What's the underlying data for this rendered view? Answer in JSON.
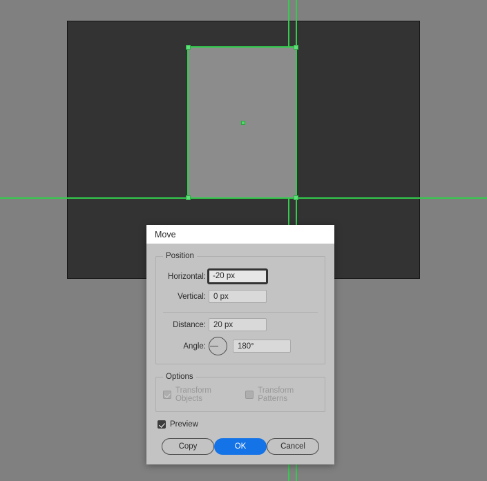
{
  "canvas": {
    "background_color": "#808080",
    "artboard_color": "#333333",
    "shape_fill": "#8c8c8c",
    "guide_color": "#33cc4d",
    "selection_color": "#5ee07a"
  },
  "dialog": {
    "title": "Move",
    "position_group": {
      "legend": "Position",
      "fields": [
        {
          "label": "Horizontal:",
          "value": "-20 px",
          "focused": true
        },
        {
          "label": "Vertical:",
          "value": "0 px",
          "focused": false
        },
        {
          "label": "Distance:",
          "value": "20 px",
          "focused": false
        },
        {
          "label": "Angle:",
          "value": "180°",
          "focused": false
        }
      ],
      "angle_degrees": 180
    },
    "options_group": {
      "legend": "Options",
      "checkboxes": [
        {
          "label": "Transform Objects",
          "checked": true,
          "enabled": false
        },
        {
          "label": "Transform Patterns",
          "checked": false,
          "enabled": false
        }
      ]
    },
    "preview": {
      "label": "Preview",
      "checked": true
    },
    "buttons": [
      {
        "label": "Copy",
        "style": "secondary"
      },
      {
        "label": "OK",
        "style": "primary"
      },
      {
        "label": "Cancel",
        "style": "secondary"
      }
    ],
    "accent_color": "#1473e6"
  }
}
